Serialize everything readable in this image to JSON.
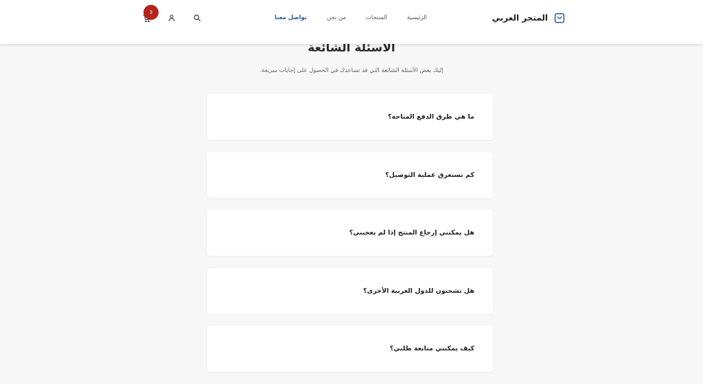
{
  "header": {
    "brand_name": "المتجر العربي",
    "nav": [
      {
        "label": "الرئيسية",
        "active": false
      },
      {
        "label": "المنتجات",
        "active": false
      },
      {
        "label": "من نحن",
        "active": false
      },
      {
        "label": "تواصل معنا",
        "active": true
      }
    ],
    "cart_count": "3",
    "icons": {
      "brand": "shopping-bag-icon",
      "search": "search-icon",
      "user": "user-icon",
      "cart": "cart-icon"
    }
  },
  "main": {
    "title": "الأسئلة الشائعة",
    "subtitle": "إليك بعض الأسئلة الشائعة التي قد تساعدك في الحصول على إجابات سريعة.",
    "faqs": [
      {
        "question": "ما هي طرق الدفع المتاحة؟"
      },
      {
        "question": "كم تستغرق عملية التوصيل؟"
      },
      {
        "question": "هل يمكنني إرجاع المنتج إذا لم يعجبني؟"
      },
      {
        "question": "هل تشحنون للدول العربية الأخرى؟"
      },
      {
        "question": "كيف يمكنني متابعة طلبي؟"
      }
    ]
  },
  "colors": {
    "accent": "#1e5a9c",
    "badge": "#b4241b",
    "background": "#f7f7f7"
  }
}
